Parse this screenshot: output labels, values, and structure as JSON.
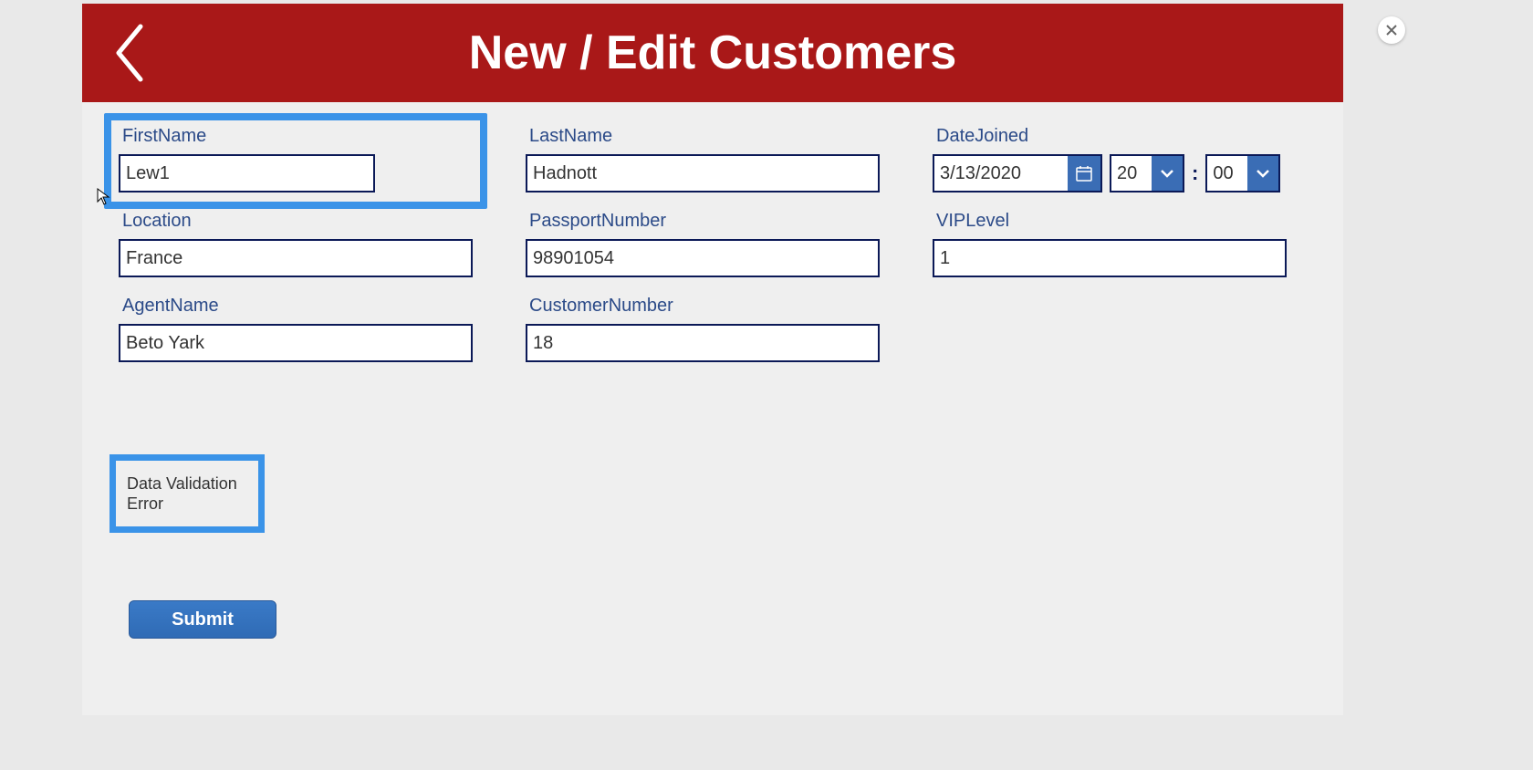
{
  "header": {
    "title": "New / Edit Customers"
  },
  "fields": {
    "firstName": {
      "label": "FirstName",
      "value": "Lew1"
    },
    "lastName": {
      "label": "LastName",
      "value": "Hadnott"
    },
    "dateJoined": {
      "label": "DateJoined",
      "date": "3/13/2020",
      "hour": "20",
      "minute": "00",
      "separator": ":"
    },
    "location": {
      "label": "Location",
      "value": "France"
    },
    "passportNumber": {
      "label": "PassportNumber",
      "value": "98901054"
    },
    "vipLevel": {
      "label": "VIPLevel",
      "value": "1"
    },
    "agentName": {
      "label": "AgentName",
      "value": "Beto Yark"
    },
    "customerNumber": {
      "label": "CustomerNumber",
      "value": "18"
    }
  },
  "error": {
    "text": "Data Validation Error"
  },
  "buttons": {
    "submit": "Submit"
  },
  "colors": {
    "headerBg": "#a91818",
    "accent": "#3a93e8",
    "inputBorder": "#0b1957",
    "label": "#2b4a88",
    "submit": "#3a7ac7"
  }
}
